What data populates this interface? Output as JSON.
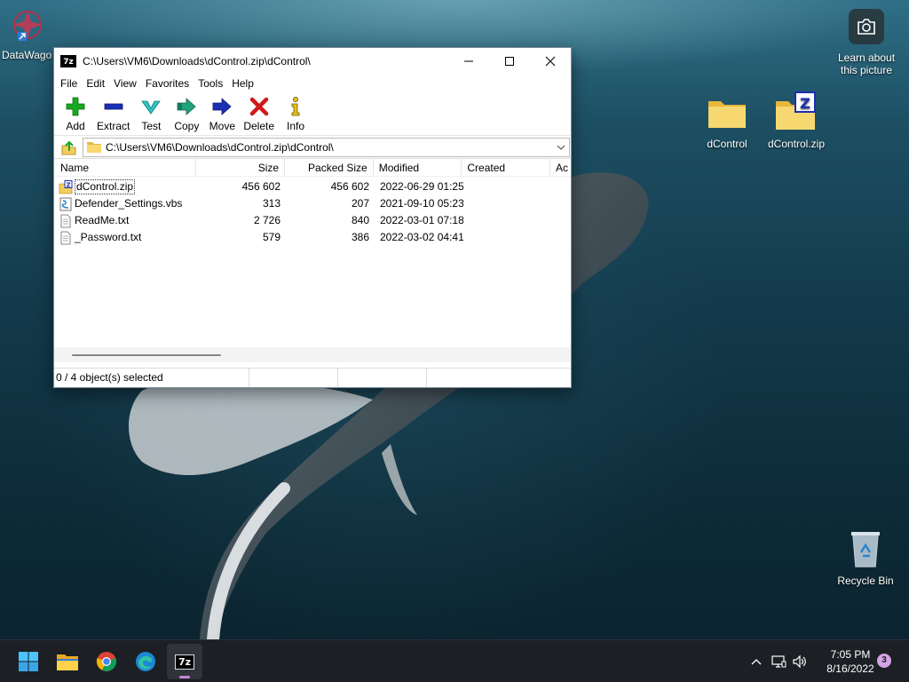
{
  "desktop": {
    "icons": [
      {
        "label": "DataWago"
      },
      {
        "label": "dControl"
      },
      {
        "label": "dControl.zip"
      },
      {
        "label": "Recycle Bin"
      }
    ],
    "camera": {
      "label_line1": "Learn about",
      "label_line2": "this picture"
    }
  },
  "window": {
    "title": "C:\\Users\\VM6\\Downloads\\dControl.zip\\dControl\\",
    "app_icon_text": "7z",
    "menu": [
      "File",
      "Edit",
      "View",
      "Favorites",
      "Tools",
      "Help"
    ],
    "toolbar": [
      {
        "label": "Add",
        "icon": "plus-icon"
      },
      {
        "label": "Extract",
        "icon": "minus-icon"
      },
      {
        "label": "Test",
        "icon": "test-check-icon"
      },
      {
        "label": "Copy",
        "icon": "copy-arrow-icon"
      },
      {
        "label": "Move",
        "icon": "move-arrow-icon"
      },
      {
        "label": "Delete",
        "icon": "delete-x-icon"
      },
      {
        "label": "Info",
        "icon": "info-icon"
      }
    ],
    "address": "C:\\Users\\VM6\\Downloads\\dControl.zip\\dControl\\",
    "columns": [
      "Name",
      "Size",
      "Packed Size",
      "Modified",
      "Created",
      "Ac"
    ],
    "files": [
      {
        "name": "dControl.zip",
        "size": "456 602",
        "packed": "456 602",
        "modified": "2022-06-29 01:25",
        "created": "",
        "type": "zip"
      },
      {
        "name": "Defender_Settings.vbs",
        "size": "313",
        "packed": "207",
        "modified": "2021-09-10 05:23",
        "created": "",
        "type": "script"
      },
      {
        "name": "ReadMe.txt",
        "size": "2 726",
        "packed": "840",
        "modified": "2022-03-01 07:18",
        "created": "",
        "type": "text"
      },
      {
        "name": "_Password.txt",
        "size": "579",
        "packed": "386",
        "modified": "2022-03-02 04:41",
        "created": "",
        "type": "text"
      }
    ],
    "status": "0 / 4 object(s) selected"
  },
  "taskbar": {
    "apps": [
      "start-icon",
      "file-explorer-icon",
      "chrome-icon",
      "edge-icon",
      "7zip-icon"
    ],
    "active_app": "7z",
    "time": "7:05 PM",
    "date": "8/16/2022",
    "notification_count": "3"
  },
  "colors": {
    "accent": "#c486d9",
    "add_green": "#17a81f",
    "extract_blue": "#1a2fb4",
    "delete_red": "#d11919",
    "folder_yellow": "#f4cf5d"
  }
}
